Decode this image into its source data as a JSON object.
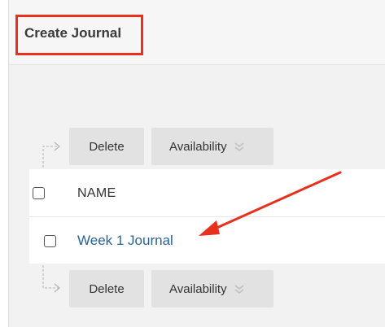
{
  "page": {
    "title": "Create Journal"
  },
  "toolbar_top": {
    "delete_label": "Delete",
    "availability_label": "Availability"
  },
  "toolbar_bottom": {
    "delete_label": "Delete",
    "availability_label": "Availability"
  },
  "list": {
    "columns": [
      {
        "label": "NAME"
      }
    ],
    "rows": [
      {
        "name": "Week 1 Journal"
      }
    ]
  },
  "colors": {
    "highlight": "#e8301c",
    "annotation_arrow": "#e8301c",
    "link": "#2a6496",
    "button_bg": "#e2e2e2",
    "panel_bg": "#f2f2f2"
  },
  "icons": {
    "availability_caret": "double-chevron-down-icon",
    "tree_connector": "tree-connector-arrow-icon"
  }
}
